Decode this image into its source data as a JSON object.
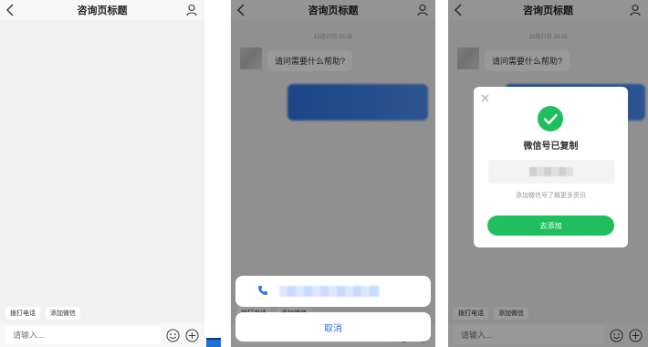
{
  "header": {
    "title": "咨询页标题"
  },
  "chat": {
    "timestamp_screen2": "12月27日   10:15",
    "timestamp_screen3": "12月27日   10:15",
    "greeting": "请问需要什么帮助?"
  },
  "quick_actions": {
    "call": "拨打电话",
    "wechat": "添加微信"
  },
  "input": {
    "placeholder": "请输入..."
  },
  "action_sheet": {
    "cancel": "取消"
  },
  "modal": {
    "title": "微信号已复制",
    "hint": "添加微信号了解更多资讯",
    "add_button": "去添加"
  },
  "colors": {
    "accent_blue": "#2f74e2",
    "wechat_green": "#1fbf5f"
  },
  "icons": [
    "back-arrow-icon",
    "user-icon",
    "emoji-icon",
    "plus-icon",
    "phone-icon",
    "close-icon",
    "checkmark-icon"
  ]
}
